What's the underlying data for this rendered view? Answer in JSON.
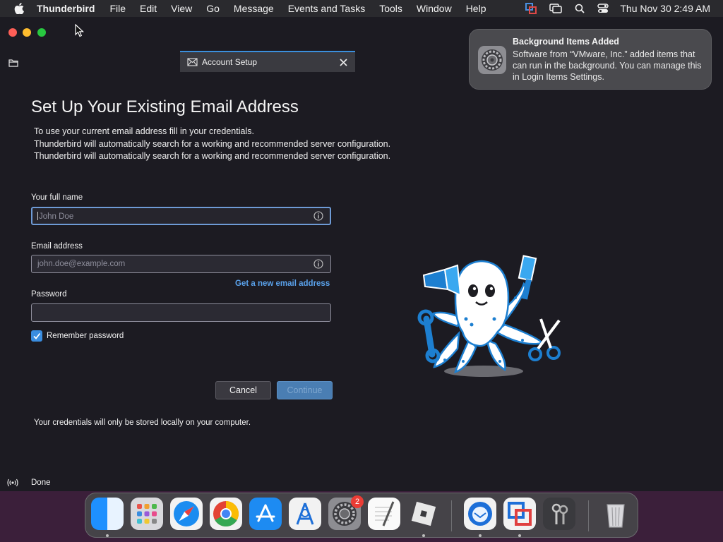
{
  "menubar": {
    "app_name": "Thunderbird",
    "items": [
      "File",
      "Edit",
      "View",
      "Go",
      "Message",
      "Events and Tasks",
      "Tools",
      "Window",
      "Help"
    ],
    "clock": "Thu Nov 30  2:49 AM",
    "icons": [
      "apple-logo",
      "vmware-status-icon",
      "screen-mirroring-icon",
      "search-icon",
      "control-center-icon"
    ]
  },
  "tab": {
    "label": "Account Setup",
    "icon": "account-setup-envelope-icon"
  },
  "setup": {
    "title": "Set Up Your Existing Email Address",
    "intro": [
      "To use your current email address fill in your credentials.",
      "Thunderbird will automatically search for a working and recommended server configuration.",
      "Thunderbird will automatically search for a working and recommended server configuration."
    ],
    "name_label": "Your full name",
    "name_placeholder": "John Doe",
    "name_value": "",
    "email_label": "Email address",
    "email_placeholder": "john.doe@example.com",
    "email_value": "",
    "new_address_link": "Get a new email address",
    "password_label": "Password",
    "password_value": "",
    "remember_label": "Remember password",
    "remember_checked": true,
    "cancel_label": "Cancel",
    "continue_label": "Continue",
    "note": "Your credentials will only be stored locally on your computer."
  },
  "status": {
    "text": "Done"
  },
  "notification": {
    "title": "Background Items Added",
    "body": "Software from “VMware, Inc.” added items that can run in the background. You can manage this in Login Items Settings."
  },
  "dock": {
    "apps": [
      "Finder",
      "Launchpad",
      "Safari",
      "Google Chrome",
      "App Store",
      "Xcode Instruments",
      "System Settings",
      "TextEdit",
      "Roblox",
      "Thunderbird",
      "VMware Fusion",
      "Keychain Access",
      "Trash"
    ],
    "settings_badge": "2"
  },
  "colors": {
    "accent": "#3b8fdc",
    "link": "#5aa2ec",
    "background": "#1c1b22"
  }
}
